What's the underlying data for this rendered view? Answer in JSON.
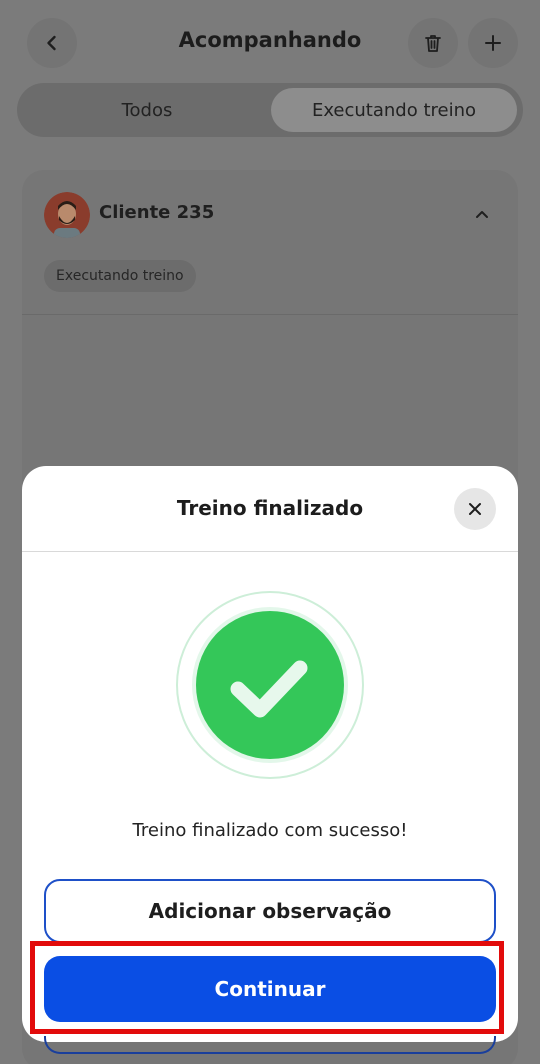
{
  "header": {
    "title": "Acompanhando"
  },
  "tabs": [
    {
      "label": "Todos",
      "selected": false
    },
    {
      "label": "Executando treino",
      "selected": true
    }
  ],
  "client_card": {
    "name": "Cliente 235",
    "tag": "Executando treino"
  },
  "modal": {
    "title": "Treino finalizado",
    "message": "Treino finalizado com sucesso!",
    "add_note_label": "Adicionar observação",
    "continue_label": "Continuar"
  },
  "colors": {
    "primary": "#0a4ee4",
    "success": "#34c759",
    "highlight": "#e20b0b"
  }
}
